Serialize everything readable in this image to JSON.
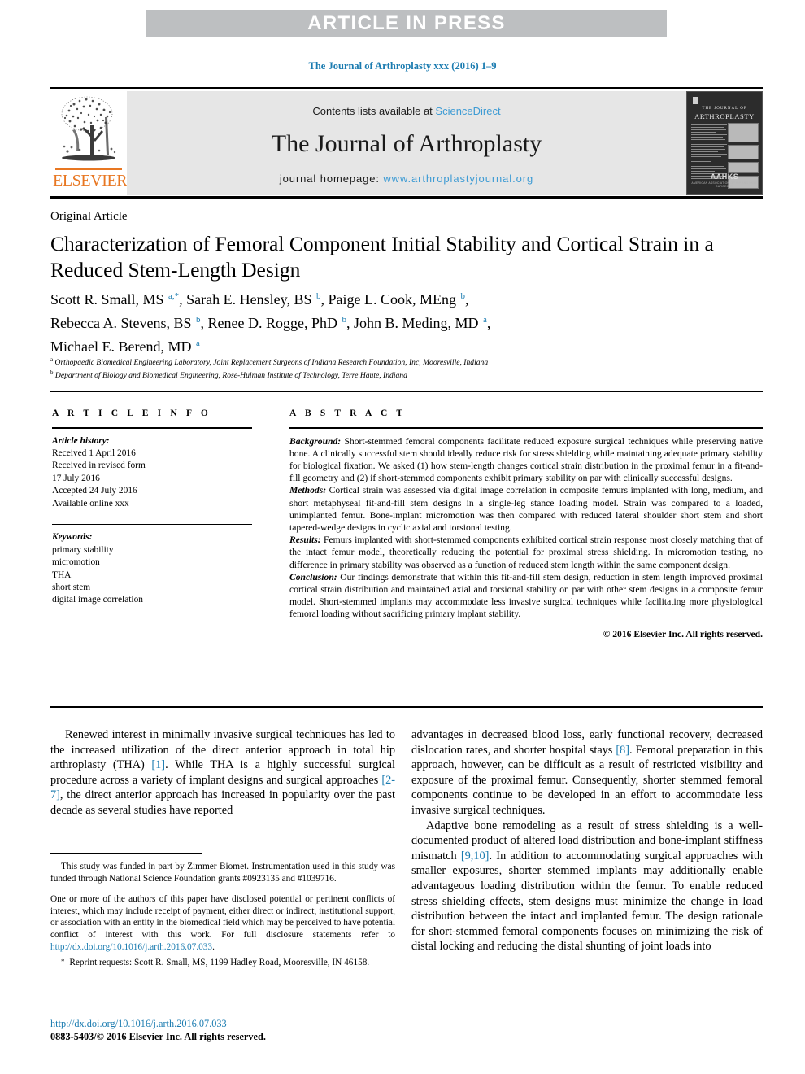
{
  "banner": {
    "text": "ARTICLE IN PRESS"
  },
  "running_head": {
    "text": "The Journal of Arthroplasty xxx (2016) 1–9"
  },
  "masthead": {
    "publisher_logo_label": "ELSEVIER",
    "contents_prefix": "Contents lists available at ",
    "contents_link": "ScienceDirect",
    "journal_name": "The Journal of Arthroplasty",
    "homepage_prefix": "journal homepage: ",
    "homepage_url": "www.arthroplastyjournal.org",
    "cover": {
      "line1": "THE JOURNAL OF",
      "line2": "ARTHROPLASTY",
      "society": "AAHKS",
      "society_sub": "AMERICAN ASSOCIATION OF HIP AND KNEE SURGEONS"
    }
  },
  "article": {
    "type": "Original Article",
    "title": "Characterization of Femoral Component Initial Stability and Cortical Strain in a Reduced Stem-Length Design",
    "authors_line1_a": "Scott R. Small, MS ",
    "authors": "Scott R. Small, MS a,*, Sarah E. Hensley, BS b, Paige L. Cook, MEng b, Rebecca A. Stevens, BS b, Renee D. Rogge, PhD b, John B. Meding, MD a, Michael E. Berend, MD a",
    "affiliation_a": "Orthopaedic Biomedical Engineering Laboratory, Joint Replacement Surgeons of Indiana Research Foundation, Inc, Mooresville, Indiana",
    "affiliation_b": "Department of Biology and Biomedical Engineering, Rose-Hulman Institute of Technology, Terre Haute, Indiana"
  },
  "info": {
    "heading": "A R T I C L E  I N F O",
    "history_label": "Article history:",
    "history": [
      "Received 1 April 2016",
      "Received in revised form",
      "17 July 2016",
      "Accepted 24 July 2016",
      "Available online xxx"
    ],
    "keywords_label": "Keywords:",
    "keywords": [
      "primary stability",
      "micromotion",
      "THA",
      "short stem",
      "digital image correlation"
    ]
  },
  "abstract": {
    "heading": "A B S T R A C T",
    "background_label": "Background:",
    "background": " Short-stemmed femoral components facilitate reduced exposure surgical techniques while preserving native bone. A clinically successful stem should ideally reduce risk for stress shielding while maintaining adequate primary stability for biological fixation. We asked (1) how stem-length changes cortical strain distribution in the proximal femur in a fit-and-fill geometry and (2) if short-stemmed components exhibit primary stability on par with clinically successful designs.",
    "methods_label": "Methods:",
    "methods": " Cortical strain was assessed via digital image correlation in composite femurs implanted with long, medium, and short metaphyseal fit-and-fill stem designs in a single-leg stance loading model. Strain was compared to a loaded, unimplanted femur. Bone-implant micromotion was then compared with reduced lateral shoulder short stem and short tapered-wedge designs in cyclic axial and torsional testing.",
    "results_label": "Results:",
    "results": " Femurs implanted with short-stemmed components exhibited cortical strain response most closely matching that of the intact femur model, theoretically reducing the potential for proximal stress shielding. In micromotion testing, no difference in primary stability was observed as a function of reduced stem length within the same component design.",
    "conclusion_label": "Conclusion:",
    "conclusion": " Our findings demonstrate that within this fit-and-fill stem design, reduction in stem length improved proximal cortical strain distribution and maintained axial and torsional stability on par with other stem designs in a composite femur model. Short-stemmed implants may accommodate less invasive surgical techniques while facilitating more physiological femoral loading without sacrificing primary implant stability.",
    "copyright": "© 2016 Elsevier Inc. All rights reserved."
  },
  "body": {
    "left_p1_a": "Renewed interest in minimally invasive surgical techniques has led to the increased utilization of the direct anterior approach in total hip arthroplasty (THA) ",
    "left_p1_ref1": "[1]",
    "left_p1_b": ". While THA is a highly successful surgical procedure across a variety of implant designs and surgical approaches ",
    "left_p1_ref2": "[2-7]",
    "left_p1_c": ", the direct anterior approach has increased in popularity over the past decade as several studies have reported",
    "right_p1_a": "advantages in decreased blood loss, early functional recovery, decreased dislocation rates, and shorter hospital stays ",
    "right_p1_ref1": "[8]",
    "right_p1_b": ". Femoral preparation in this approach, however, can be difficult as a result of restricted visibility and exposure of the proximal femur. Consequently, shorter stemmed femoral components continue to be developed in an effort to accommodate less invasive surgical techniques.",
    "right_p2_a": "Adaptive bone remodeling as a result of stress shielding is a well-documented product of altered load distribution and bone-implant stiffness mismatch ",
    "right_p2_ref1": "[9,10]",
    "right_p2_b": ". In addition to accommodating surgical approaches with smaller exposures, shorter stemmed implants may additionally enable advantageous loading distribution within the femur. To enable reduced stress shielding effects, stem designs must minimize the change in load distribution between the intact and implanted femur. The design rationale for short-stemmed femoral components focuses on minimizing the risk of distal locking and reducing the distal shunting of joint loads into"
  },
  "footnotes": {
    "funding": "This study was funded in part by Zimmer Biomet. Instrumentation used in this study was funded through National Science Foundation grants #0923135 and #1039716.",
    "disclosure_a": "One or more of the authors of this paper have disclosed potential or pertinent conflicts of interest, which may include receipt of payment, either direct or indirect, institutional support, or association with an entity in the biomedical field which may be perceived to have potential conflict of interest with this work. For full disclosure statements refer to ",
    "disclosure_link": "http://dx.doi.org/10.1016/j.arth.2016.07.033",
    "disclosure_end": ".",
    "reprint_marker": "*",
    "reprint": " Reprint requests: Scott R. Small, MS, 1199 Hadley Road, Mooresville, IN 46158."
  },
  "doi_block": {
    "doi": "http://dx.doi.org/10.1016/j.arth.2016.07.033",
    "issn": "0883-5403/© 2016 Elsevier Inc. All rights reserved."
  },
  "colors": {
    "link": "#1a7bb0",
    "sciencedirect": "#3d9bd4",
    "elsevier_orange": "#e87722",
    "banner_gray": "#bdbfc1",
    "masthead_gray": "#e6e6e6"
  }
}
